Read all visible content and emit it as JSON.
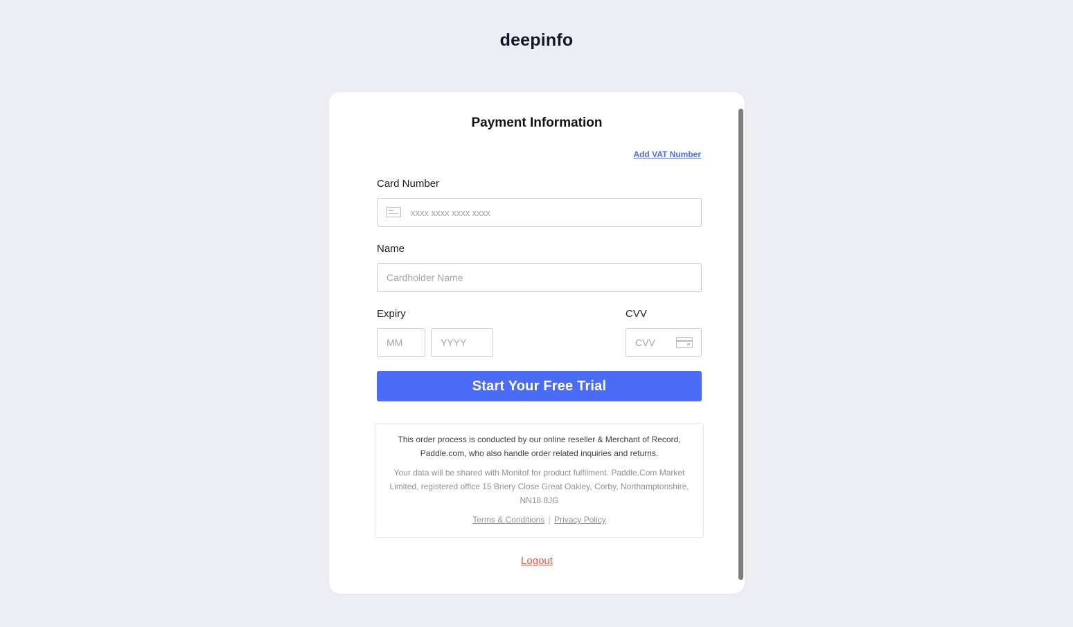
{
  "brand": {
    "name": "deepinfo"
  },
  "form": {
    "title": "Payment Information",
    "vat_link": "Add VAT Number",
    "card_number_label": "Card Number",
    "card_number_placeholder": "xxxx xxxx xxxx xxxx",
    "card_number_value": "",
    "name_label": "Name",
    "name_placeholder": "Cardholder Name",
    "name_value": "",
    "expiry_label": "Expiry",
    "month_placeholder": "MM",
    "year_placeholder": "YYYY",
    "cvv_label": "CVV",
    "cvv_placeholder": "CVV",
    "submit_label": "Start Your Free Trial"
  },
  "notice": {
    "main": "This order process is conducted by our online reseller & Merchant of Record, Paddle.com, who also handle order related inquiries and returns.",
    "sub": "Your data will be shared with Monitof for product fulfilment. Paddle.Com Market Limited, registered office 15 Briery Close Great Oakley, Corby, Northamptonshire, NN18 8JG",
    "terms_label": "Terms & Conditions",
    "separator": "|",
    "privacy_label": "Privacy Policy"
  },
  "footer": {
    "logout_label": "Logout"
  },
  "icons": {
    "card_number": "credit-card-icon",
    "cvv": "card-back-icon"
  },
  "colors": {
    "accent": "#4a6cf7",
    "logout": "#e8563a",
    "background": "#eceef3"
  }
}
